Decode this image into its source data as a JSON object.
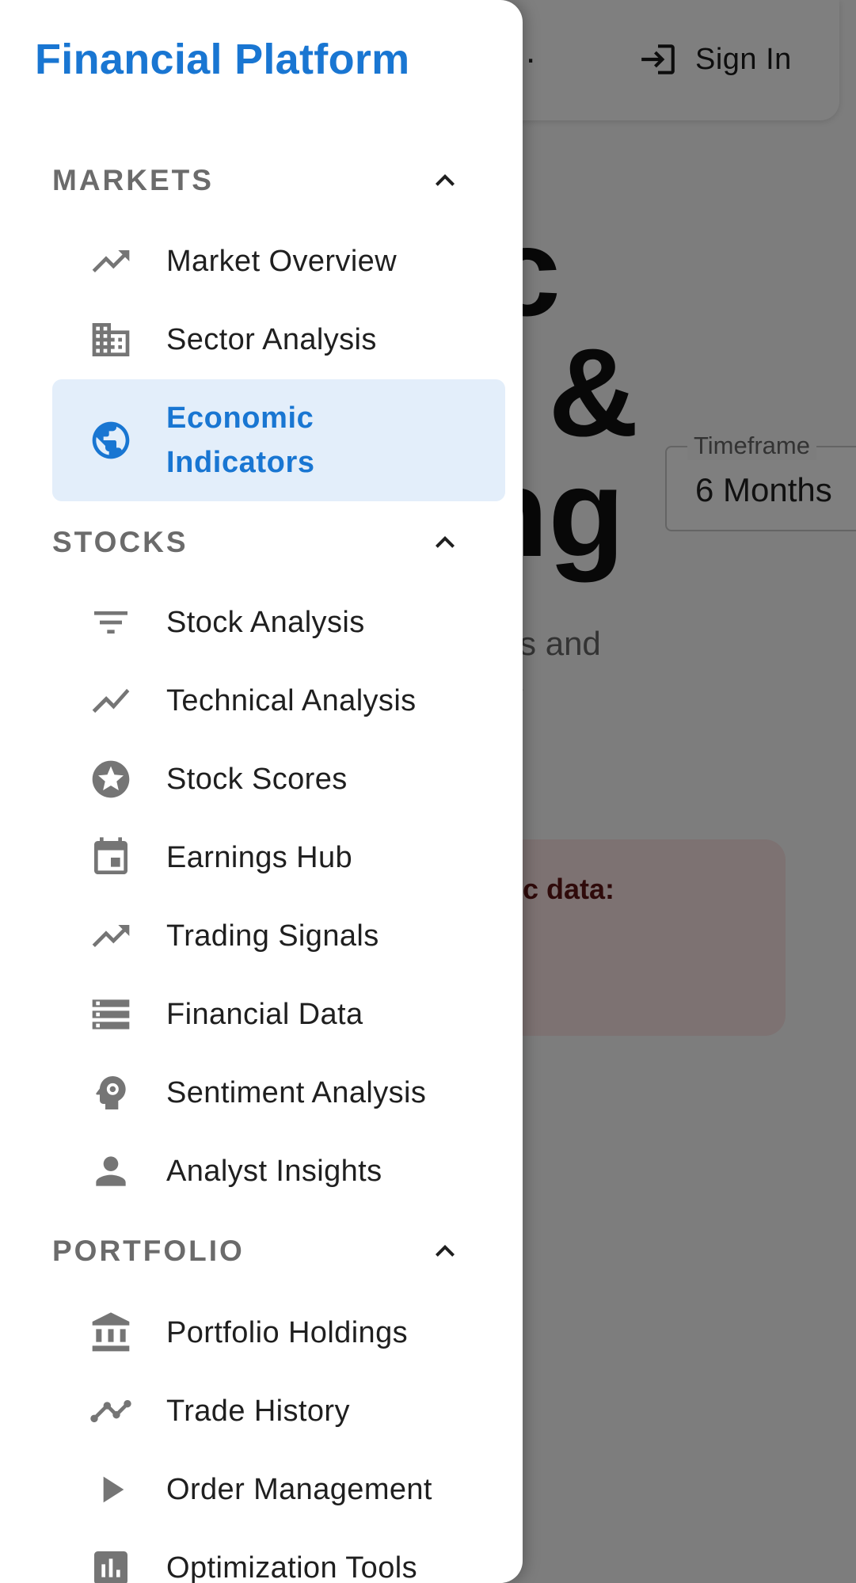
{
  "background": {
    "app_bar_dot": ".",
    "sign_in_label": "Sign In",
    "hero_title_lines": [
      "c",
      "g &",
      "ing"
    ],
    "timeframe_label": "Timeframe",
    "timeframe_value": "6 Months",
    "subtitle": "dels and\nility",
    "alert_text": "c data:"
  },
  "drawer": {
    "brand": "Financial Platform",
    "sections": {
      "markets": {
        "label": "MARKETS"
      },
      "stocks": {
        "label": "STOCKS"
      },
      "portfolio": {
        "label": "PORTFOLIO"
      }
    },
    "items": {
      "market_overview": "Market Overview",
      "sector_analysis": "Sector Analysis",
      "economic_indicators": "Economic Indicators",
      "stock_analysis": "Stock Analysis",
      "technical_analysis": "Technical Analysis",
      "stock_scores": "Stock Scores",
      "earnings_hub": "Earnings Hub",
      "trading_signals": "Trading Signals",
      "financial_data": "Financial Data",
      "sentiment_analysis": "Sentiment Analysis",
      "analyst_insights": "Analyst Insights",
      "portfolio_holdings": "Portfolio Holdings",
      "trade_history": "Trade History",
      "order_management": "Order Management",
      "optimization_tools": "Optimization Tools"
    }
  },
  "colors": {
    "brand": "#1976d2",
    "selected_bg": "#e3eefa",
    "icon_gray": "#757575",
    "section_label": "#6b6b6b",
    "scrim": "rgba(0,0,0,0.5)"
  }
}
